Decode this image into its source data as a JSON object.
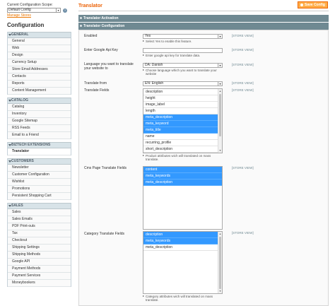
{
  "sidebar": {
    "scope_label": "Current Configuration Scope:",
    "scope_value": "Default Config",
    "manage_stores": "Manage Stores",
    "config_title": "Configuration",
    "sections": [
      {
        "title": "GENERAL",
        "items": [
          "General",
          "Web",
          "Design",
          "Currency Setup",
          "Store Email Addresses",
          "Contacts",
          "Reports",
          "Content Management"
        ]
      },
      {
        "title": "CATALOG",
        "items": [
          "Catalog",
          "Inventory",
          "Google Sitemap",
          "RSS Feeds",
          "Email to a Friend"
        ]
      },
      {
        "title": "BIZTECH EXTENSIONS",
        "items": [
          "Translator"
        ]
      },
      {
        "title": "CUSTOMERS",
        "items": [
          "Newsletter",
          "Customer Configuration",
          "Wishlist",
          "Promotions",
          "Persistent Shopping Cart"
        ]
      },
      {
        "title": "SALES",
        "items": [
          "Sales",
          "Sales Emails",
          "PDF Print-outs",
          "Tax",
          "Checkout",
          "Shipping Settings",
          "Shipping Methods",
          "Google API",
          "Payment Methods",
          "Payment Services",
          "Moneybookers"
        ]
      }
    ],
    "active_item": "Translator"
  },
  "header": {
    "title": "Translator",
    "save_label": "Save Config"
  },
  "fieldsets": {
    "activation": "Translator Activation",
    "configuration": "Translator Configuration"
  },
  "form": {
    "store_view": "[STORE VIEW]",
    "enabled": {
      "label": "Enabled",
      "value": "Yes",
      "note": "Select Yes to enable this feature."
    },
    "api_key": {
      "label": "Enter Google Api Key",
      "value": "",
      "note": "Enter google api key for translate data."
    },
    "language": {
      "label": "Language you want to translate your website to",
      "value": "DA: Danish",
      "note": "Choose language which you want to translate your website"
    },
    "translate_from": {
      "label": "Translate from",
      "value": "EN: English"
    },
    "translate_fields": {
      "label": "Translate Fields",
      "options": [
        {
          "text": "description",
          "selected": false
        },
        {
          "text": "height",
          "selected": false
        },
        {
          "text": "image_label",
          "selected": false
        },
        {
          "text": "length",
          "selected": false
        },
        {
          "text": "meta_description",
          "selected": true
        },
        {
          "text": "meta_keyword",
          "selected": true
        },
        {
          "text": "meta_title",
          "selected": true
        },
        {
          "text": "name",
          "selected": false
        },
        {
          "text": "recurring_profile",
          "selected": false
        },
        {
          "text": "short_description",
          "selected": false
        }
      ],
      "note": "Product attributes wich will translated on mass translate."
    },
    "cms_fields": {
      "label": "Cms Page Translate Fields",
      "options": [
        {
          "text": "content",
          "selected": true
        },
        {
          "text": "meta_keywords",
          "selected": true
        },
        {
          "text": "meta_description",
          "selected": true
        }
      ]
    },
    "category_fields": {
      "label": "Category Translate Fields",
      "options": [
        {
          "text": "description",
          "selected": true
        },
        {
          "text": "meta_keywords",
          "selected": true
        },
        {
          "text": "meta_description",
          "selected": false
        }
      ],
      "note": "Category attributes wich will translated on mass translate."
    }
  },
  "colors": {
    "accent": "#eb5e00",
    "fieldset_header": "#6f8992",
    "selected_option": "#3399ff"
  }
}
